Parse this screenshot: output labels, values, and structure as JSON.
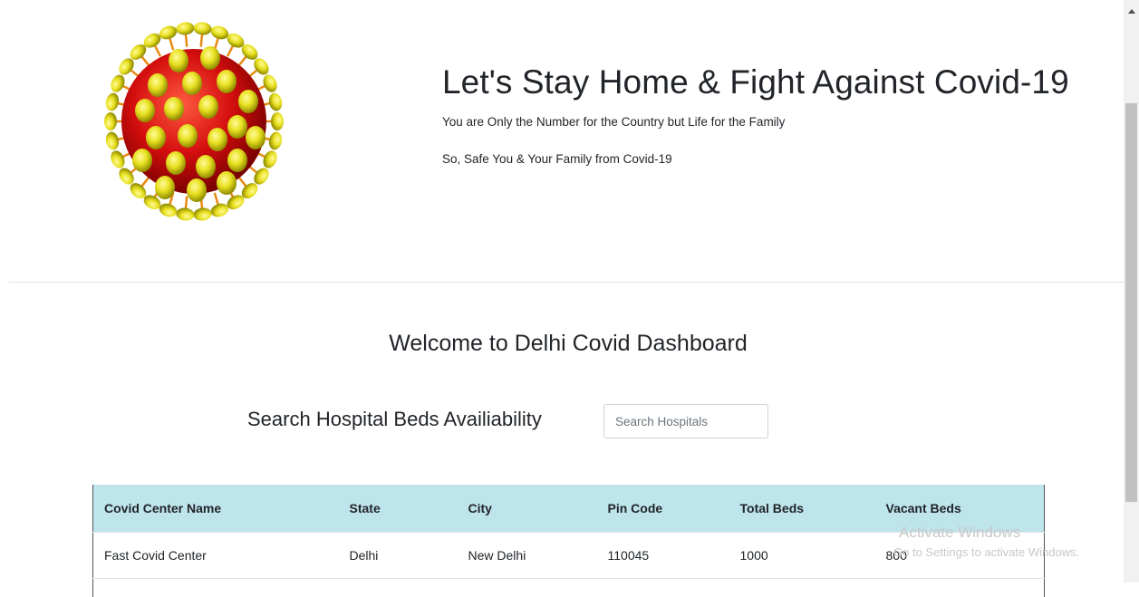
{
  "hero": {
    "headline": "Let's Stay Home & Fight Against Covid-19",
    "tagline": "You are Only the Number for the Country but Life for the Family",
    "tagline2": "So, Safe You & Your Family from Covid-19"
  },
  "dashboard": {
    "welcome": "Welcome to Delhi Covid Dashboard",
    "search_title": "Search Hospital Beds Availiability",
    "search_placeholder": "Search Hospitals"
  },
  "table": {
    "headers": [
      "Covid Center Name",
      "State",
      "City",
      "Pin Code",
      "Total Beds",
      "Vacant Beds"
    ],
    "rows": [
      [
        "Fast Covid Center",
        "Delhi",
        "New Delhi",
        "110045",
        "1000",
        "800"
      ]
    ]
  },
  "overlay": {
    "watermark_title": "Activate Windows",
    "watermark_sub": "Go to Settings to activate Windows."
  }
}
